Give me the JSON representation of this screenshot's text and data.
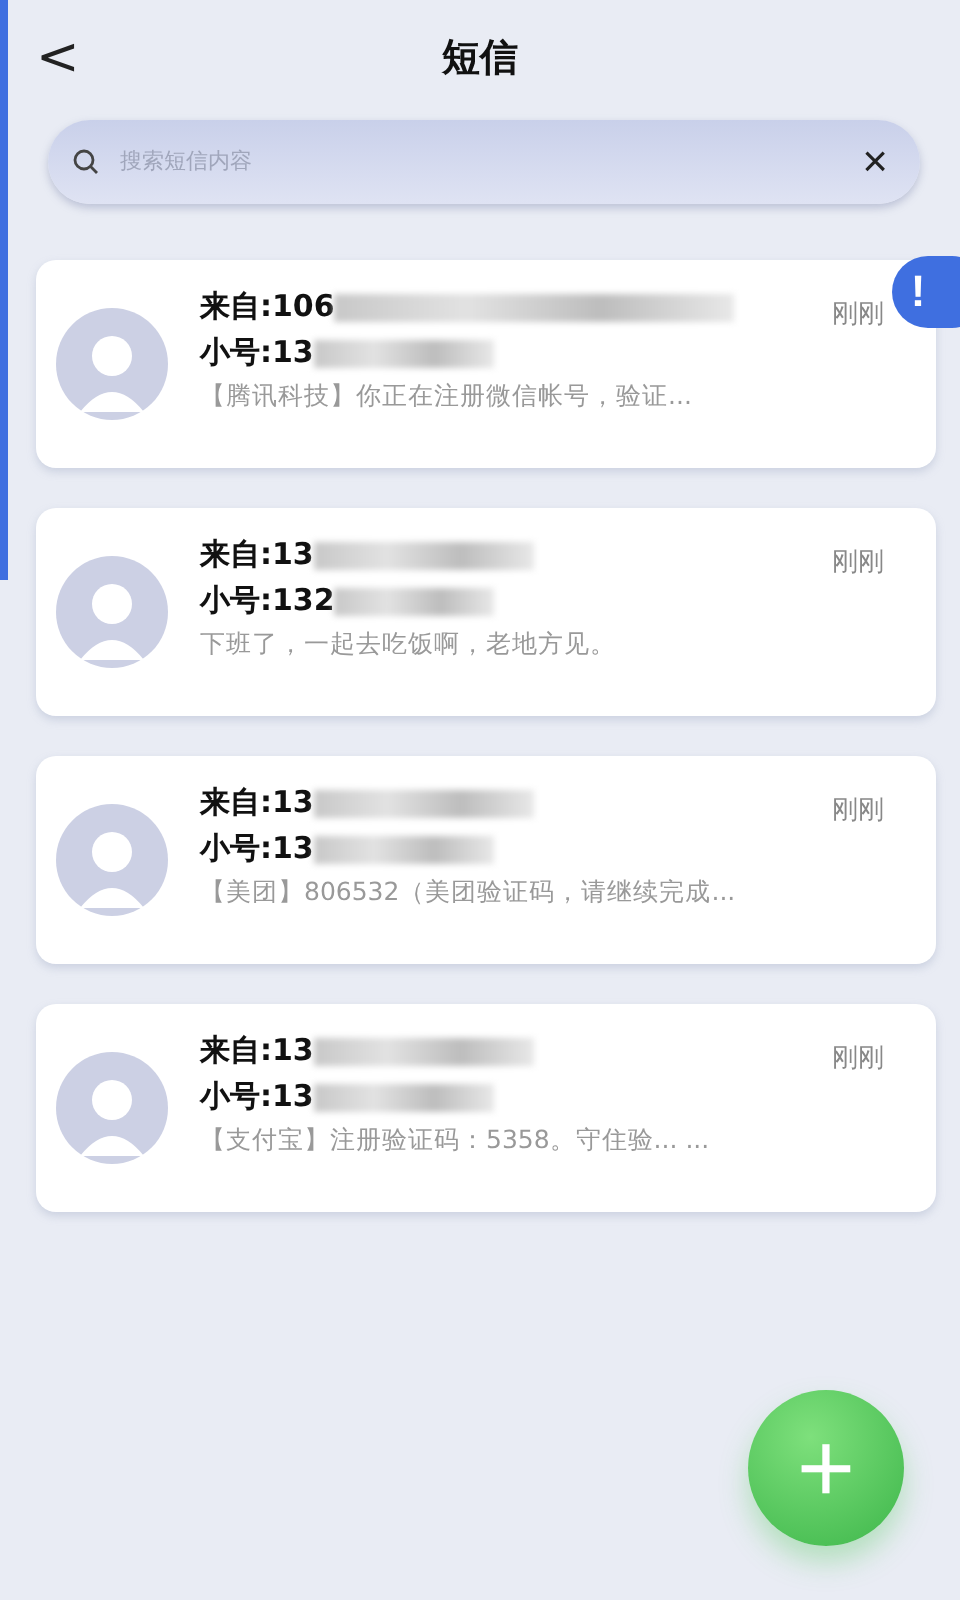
{
  "header": {
    "back": "<",
    "title": "短信"
  },
  "search": {
    "placeholder": "搜索短信内容",
    "clear": "×"
  },
  "alert_badge": "!",
  "messages": [
    {
      "from": "来自:106",
      "number": "小号:13",
      "preview": "【腾讯科技】你正在注册微信帐号，验证...",
      "time": "刚刚"
    },
    {
      "from": "来自:13",
      "number": "小号:132",
      "preview": "下班了，一起去吃饭啊，老地方见。",
      "time": "刚刚"
    },
    {
      "from": "来自:13",
      "number": "小号:13",
      "preview": "【美团】806532（美团验证码，请继续完成...",
      "time": "刚刚"
    },
    {
      "from": "来自:13",
      "number": "小号:13",
      "preview": "【支付宝】注册验证码：5358。守住验... ...",
      "time": "刚刚"
    }
  ],
  "fab": "+"
}
